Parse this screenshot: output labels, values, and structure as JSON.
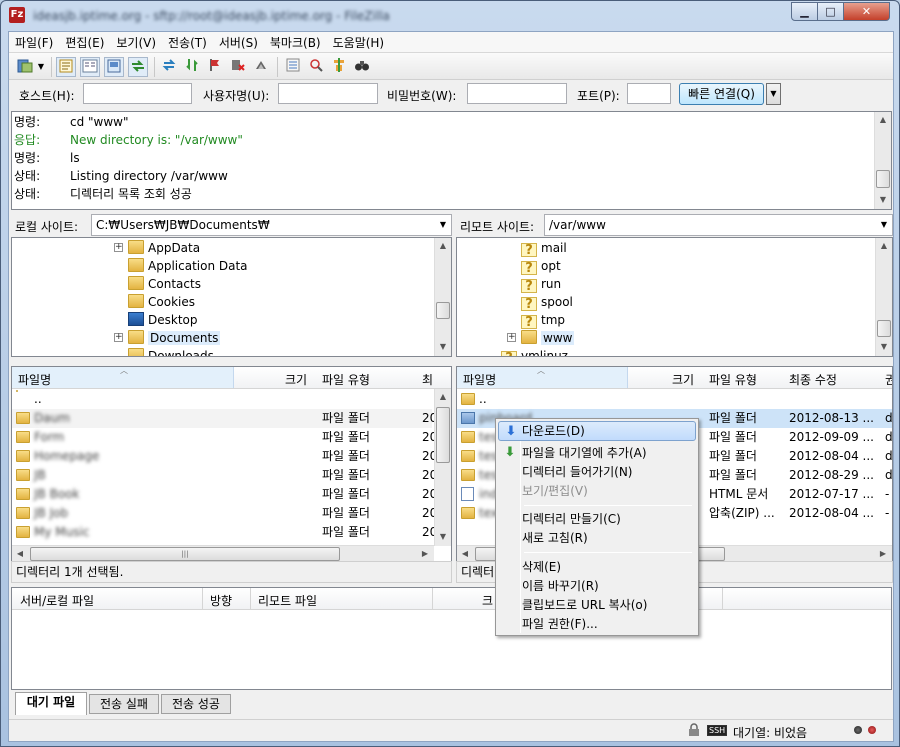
{
  "window": {
    "title": "ideasjb.iptime.org - sftp://root@ideasjb.iptime.org - FileZilla",
    "min": "▁",
    "max": "□",
    "close": "✕"
  },
  "menu": [
    "파일(F)",
    "편집(E)",
    "보기(V)",
    "전송(T)",
    "서버(S)",
    "북마크(B)",
    "도움말(H)"
  ],
  "quickconnect": {
    "host_label": "호스트(H):",
    "user_label": "사용자명(U):",
    "pass_label": "비밀번호(W):",
    "port_label": "포트(P):",
    "button": "빠른 연결(Q)",
    "dropdown": "▼"
  },
  "log": [
    {
      "key": "명령:",
      "value": "cd \"www\"",
      "color": "#000000"
    },
    {
      "key": "응답:",
      "value": "New directory is: \"/var/www\"",
      "color": "#218a21"
    },
    {
      "key": "명령:",
      "value": "ls",
      "color": "#000000"
    },
    {
      "key": "상태:",
      "value": "Listing directory /var/www",
      "color": "#000000"
    },
    {
      "key": "상태:",
      "value": "디렉터리 목록 조회 성공",
      "color": "#000000"
    }
  ],
  "local": {
    "label": "로컬 사이트:",
    "path": "C:₩Users₩JB₩Documents₩",
    "tree": [
      {
        "name": "AppData",
        "icon": "folder",
        "expander": "+"
      },
      {
        "name": "Application Data",
        "icon": "folder-link",
        "expander": ""
      },
      {
        "name": "Contacts",
        "icon": "folder",
        "expander": ""
      },
      {
        "name": "Cookies",
        "icon": "folder-link",
        "expander": ""
      },
      {
        "name": "Desktop",
        "icon": "desktop",
        "expander": ""
      },
      {
        "name": "Documents",
        "icon": "folder",
        "expander": "+",
        "selected": true
      },
      {
        "name": "Downloads",
        "icon": "folder",
        "expander": ""
      }
    ],
    "columns": [
      "파일명",
      "크기",
      "파일 유형",
      "최"
    ],
    "files": [
      {
        "name": "..",
        "type": "",
        "date": "",
        "blurred": false
      },
      {
        "name": "Daum",
        "type": "파일 폴더",
        "date": "20",
        "blurred": true
      },
      {
        "name": "Form",
        "type": "파일 폴더",
        "date": "20",
        "blurred": true
      },
      {
        "name": "Homepage",
        "type": "파일 폴더",
        "date": "20",
        "blurred": true
      },
      {
        "name": "JB",
        "type": "파일 폴더",
        "date": "20",
        "blurred": true
      },
      {
        "name": "JB Book",
        "type": "파일 폴더",
        "date": "20",
        "blurred": true
      },
      {
        "name": "JB Job",
        "type": "파일 폴더",
        "date": "20",
        "blurred": true
      },
      {
        "name": "My Music",
        "type": "파일 폴더",
        "date": "20",
        "blurred": true
      }
    ],
    "status": "디렉터리 1개 선택됨."
  },
  "remote": {
    "label": "리모트 사이트:",
    "path": "/var/www",
    "tree": [
      {
        "name": "mail",
        "icon": "question"
      },
      {
        "name": "opt",
        "icon": "question"
      },
      {
        "name": "run",
        "icon": "question"
      },
      {
        "name": "spool",
        "icon": "question"
      },
      {
        "name": "tmp",
        "icon": "question"
      },
      {
        "name": "www",
        "icon": "folder",
        "selected": true,
        "expander": "+"
      },
      {
        "name": "vmlinuz",
        "icon": "question"
      }
    ],
    "columns": [
      "파일명",
      "크기",
      "파일 유형",
      "최종 수정",
      "권"
    ],
    "files": [
      {
        "name": "..",
        "type": "",
        "date": "",
        "extra": ""
      },
      {
        "name": "pinboard",
        "type": "파일 폴더",
        "date": "2012-08-13 ...",
        "extra": "d",
        "selected": true
      },
      {
        "name": "test",
        "type": "파일 폴더",
        "date": "2012-09-09 ...",
        "extra": "d"
      },
      {
        "name": "test",
        "type": "파일 폴더",
        "date": "2012-08-04 ...",
        "extra": "d"
      },
      {
        "name": "test",
        "type": "파일 폴더",
        "date": "2012-08-29 ...",
        "extra": "d"
      },
      {
        "name": "index",
        "type": "HTML 문서",
        "date": "2012-07-17 ...",
        "extra": "-"
      },
      {
        "name": "text",
        "type": "압축(ZIP) ...",
        "date": "2012-08-04 ...",
        "extra": "-"
      }
    ],
    "status": "디렉터"
  },
  "context_menu": {
    "items": [
      {
        "label": "다운로드(D)",
        "icon": "download-arrow",
        "glyph": "⬇",
        "highlighted": true
      },
      {
        "label": "파일을 대기열에 추가(A)",
        "icon": "queue-add",
        "glyph": "⬇"
      },
      {
        "label": "디렉터리 들어가기(N)"
      },
      {
        "label": "보기/편집(V)",
        "disabled": true
      },
      {
        "separator": true
      },
      {
        "label": "디렉터리 만들기(C)"
      },
      {
        "label": "새로 고침(R)"
      },
      {
        "separator": true
      },
      {
        "label": "삭제(E)"
      },
      {
        "label": "이름 바꾸기(R)"
      },
      {
        "label": "클립보드로 URL 복사(o)"
      },
      {
        "label": "파일 권한(F)..."
      }
    ]
  },
  "queue": {
    "columns": [
      "서버/로컬 파일",
      "방향",
      "리모트 파일",
      "크"
    ]
  },
  "tabs": [
    "대기 파일",
    "전송 실패",
    "전송 성공"
  ],
  "statusbar": {
    "queue": "대기열: 비었음",
    "ssh_badge": "SSH"
  }
}
